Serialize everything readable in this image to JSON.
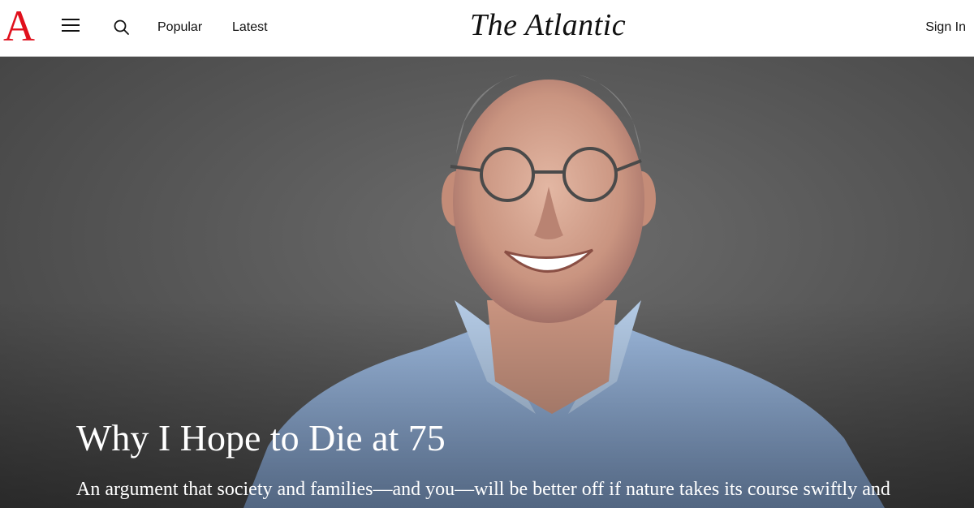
{
  "header": {
    "logo_letter": "A",
    "masthead": "The Atlantic",
    "nav": [
      {
        "label": "Popular"
      },
      {
        "label": "Latest"
      }
    ],
    "sign_in_label": "Sign In",
    "icons": [
      "menu-icon",
      "search-icon"
    ],
    "logo_color": "#e0101c"
  },
  "hero": {
    "headline": "Why I Hope to Die at 75",
    "dek": "An argument that society and families—and you—will be better off if nature takes its course swiftly and"
  }
}
